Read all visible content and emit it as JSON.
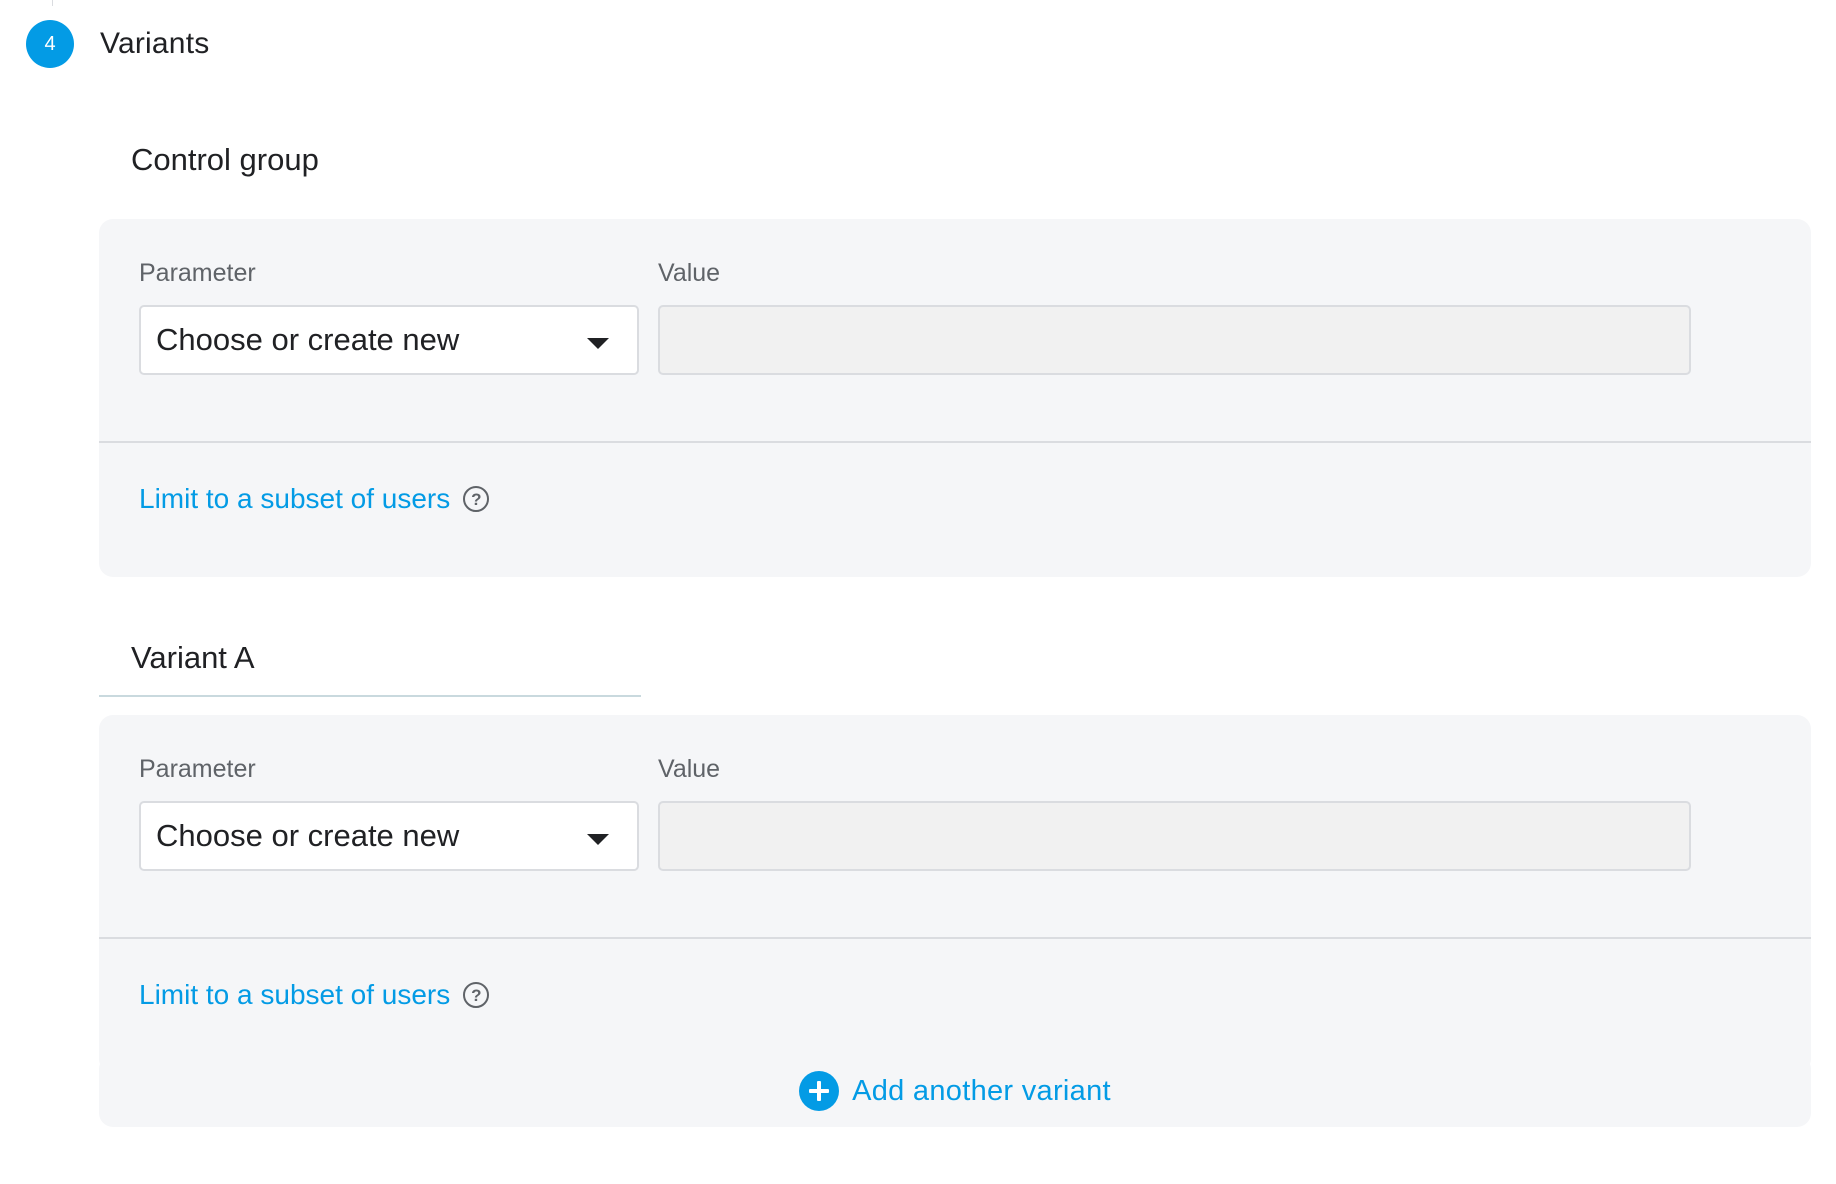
{
  "step": {
    "number": "4",
    "title": "Variants"
  },
  "control_group": {
    "title": "Control group",
    "parameter_label": "Parameter",
    "value_label": "Value",
    "parameter_select": "Choose or create new",
    "value_input": "",
    "subset_link": "Limit to a subset of users"
  },
  "variant_a": {
    "title": "Variant A",
    "parameter_label": "Parameter",
    "value_label": "Value",
    "parameter_select": "Choose or create new",
    "value_input": "",
    "subset_link": "Limit to a subset of users"
  },
  "add_variant": {
    "label": "Add another variant"
  },
  "icons": {
    "dropdown": "chevron-down-icon",
    "help": "help-circle-icon",
    "add": "add-circle-icon"
  },
  "colors": {
    "accent": "#039be5",
    "card_background": "#f5f6f8",
    "text_primary": "#202124",
    "text_secondary": "#5f6368"
  }
}
